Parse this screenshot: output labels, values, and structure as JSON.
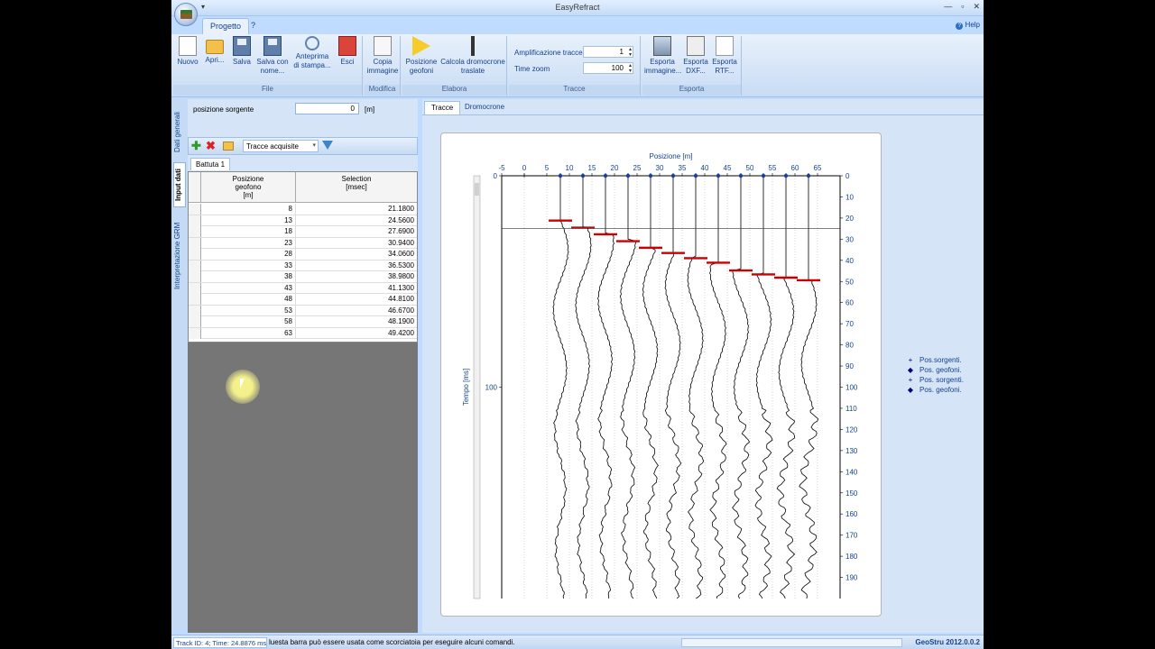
{
  "window": {
    "title": "EasyRefract",
    "controls": [
      "—",
      "▫",
      "✕"
    ]
  },
  "qat": "▾",
  "tabs": [
    {
      "label": "Progetto",
      "active": true
    },
    {
      "label": "?",
      "active": false
    }
  ],
  "help_label": "Help",
  "ribbon": {
    "groups": [
      {
        "label": "File",
        "buttons": [
          {
            "label": "Nuovo",
            "icon": "new-document-icon"
          },
          {
            "label": "Apri...",
            "icon": "open-folder-icon"
          },
          {
            "label": "Salva",
            "icon": "floppy-disk-icon"
          },
          {
            "label": "Salva con nome...",
            "icon": "save-as-icon"
          },
          {
            "label": "Anteprima di stampa...",
            "icon": "print-preview-icon"
          },
          {
            "label": "Esci",
            "icon": "exit-icon"
          }
        ]
      },
      {
        "label": "Modifica",
        "buttons": [
          {
            "label": "Copia immagine",
            "icon": "copy-image-icon"
          }
        ]
      },
      {
        "label": "Elabora",
        "buttons": [
          {
            "label": "Posizione geofoni",
            "icon": "arrow-right-icon"
          },
          {
            "label": "Calcola dromocrone traslate",
            "icon": "calc-icon"
          }
        ]
      },
      {
        "label": "Tracce",
        "fields": [
          {
            "label": "Amplificazione tracce",
            "value": "1"
          },
          {
            "label": "Time zoom",
            "value": "100"
          }
        ]
      },
      {
        "label": "Esporta",
        "buttons": [
          {
            "label": "Esporta immagine...",
            "icon": "export-image-icon"
          },
          {
            "label": "Esporta DXF...",
            "icon": "export-dxf-icon"
          },
          {
            "label": "Esporta RTF...",
            "icon": "export-rtf-icon"
          }
        ]
      }
    ]
  },
  "side_tabs": [
    {
      "label": "Dati generali",
      "active": false
    },
    {
      "label": "Input dati",
      "active": true
    },
    {
      "label": "Interpretazione GRM",
      "active": false
    }
  ],
  "source": {
    "label": "posizione sorgente",
    "value": "0",
    "unit": "[m]"
  },
  "toolbar": {
    "combo": "Tracce acquisite"
  },
  "battuta_tab": "Battuta 1",
  "table": {
    "headers": [
      "Posizione\ngeofono\n[m]",
      "Selection\n[msec]"
    ],
    "rows": [
      [
        "8",
        "21.1800"
      ],
      [
        "13",
        "24.5600"
      ],
      [
        "18",
        "27.6900"
      ],
      [
        "23",
        "30.9400"
      ],
      [
        "28",
        "34.0600"
      ],
      [
        "33",
        "36.5300"
      ],
      [
        "38",
        "38.9800"
      ],
      [
        "43",
        "41.1300"
      ],
      [
        "48",
        "44.8100"
      ],
      [
        "53",
        "46.6700"
      ],
      [
        "58",
        "48.1900"
      ],
      [
        "63",
        "49.4200"
      ]
    ]
  },
  "content_tabs": [
    {
      "label": "Tracce",
      "active": true
    },
    {
      "label": "Dromocrone",
      "active": false
    }
  ],
  "chart_data": {
    "type": "line",
    "title": "",
    "xlabel": "Posizione [m]",
    "ylabel": "Tempo [ms]",
    "xlim": [
      -5,
      70
    ],
    "ylim": [
      0,
      200
    ],
    "x_ticks": [
      -5,
      0,
      5,
      10,
      15,
      20,
      25,
      30,
      35,
      40,
      45,
      50,
      55,
      60,
      65
    ],
    "y_ticks_right": [
      0,
      10,
      20,
      30,
      40,
      50,
      60,
      70,
      80,
      90,
      100,
      110,
      120,
      130,
      140,
      150,
      160,
      170,
      180,
      190
    ],
    "y_ticks_left": [
      0,
      100
    ],
    "trace_positions": [
      8,
      13,
      18,
      23,
      28,
      33,
      38,
      43,
      48,
      53,
      58,
      63
    ],
    "picks_ms": [
      21.18,
      24.56,
      27.69,
      30.94,
      34.06,
      36.53,
      38.98,
      41.13,
      44.81,
      46.67,
      48.19,
      49.42
    ],
    "cursor_time_ms": 24.8876,
    "pick_color": "#cc0000",
    "trace_color": "#000000",
    "legend": [
      {
        "marker": "+",
        "label": "Pos.sorgenti."
      },
      {
        "marker": "◆",
        "label": "Pos. geofoni."
      },
      {
        "marker": "+",
        "label": "Pos. sorgenti."
      },
      {
        "marker": "◆",
        "label": "Pos. geofoni."
      }
    ]
  },
  "status": {
    "track": "Track ID: 4; Time: 24.8876 ms",
    "message": "luesta barra può essere usata come scorciatoia per eseguire alcuni comandi.",
    "version": "GeoStru 2012.0.0.2"
  }
}
